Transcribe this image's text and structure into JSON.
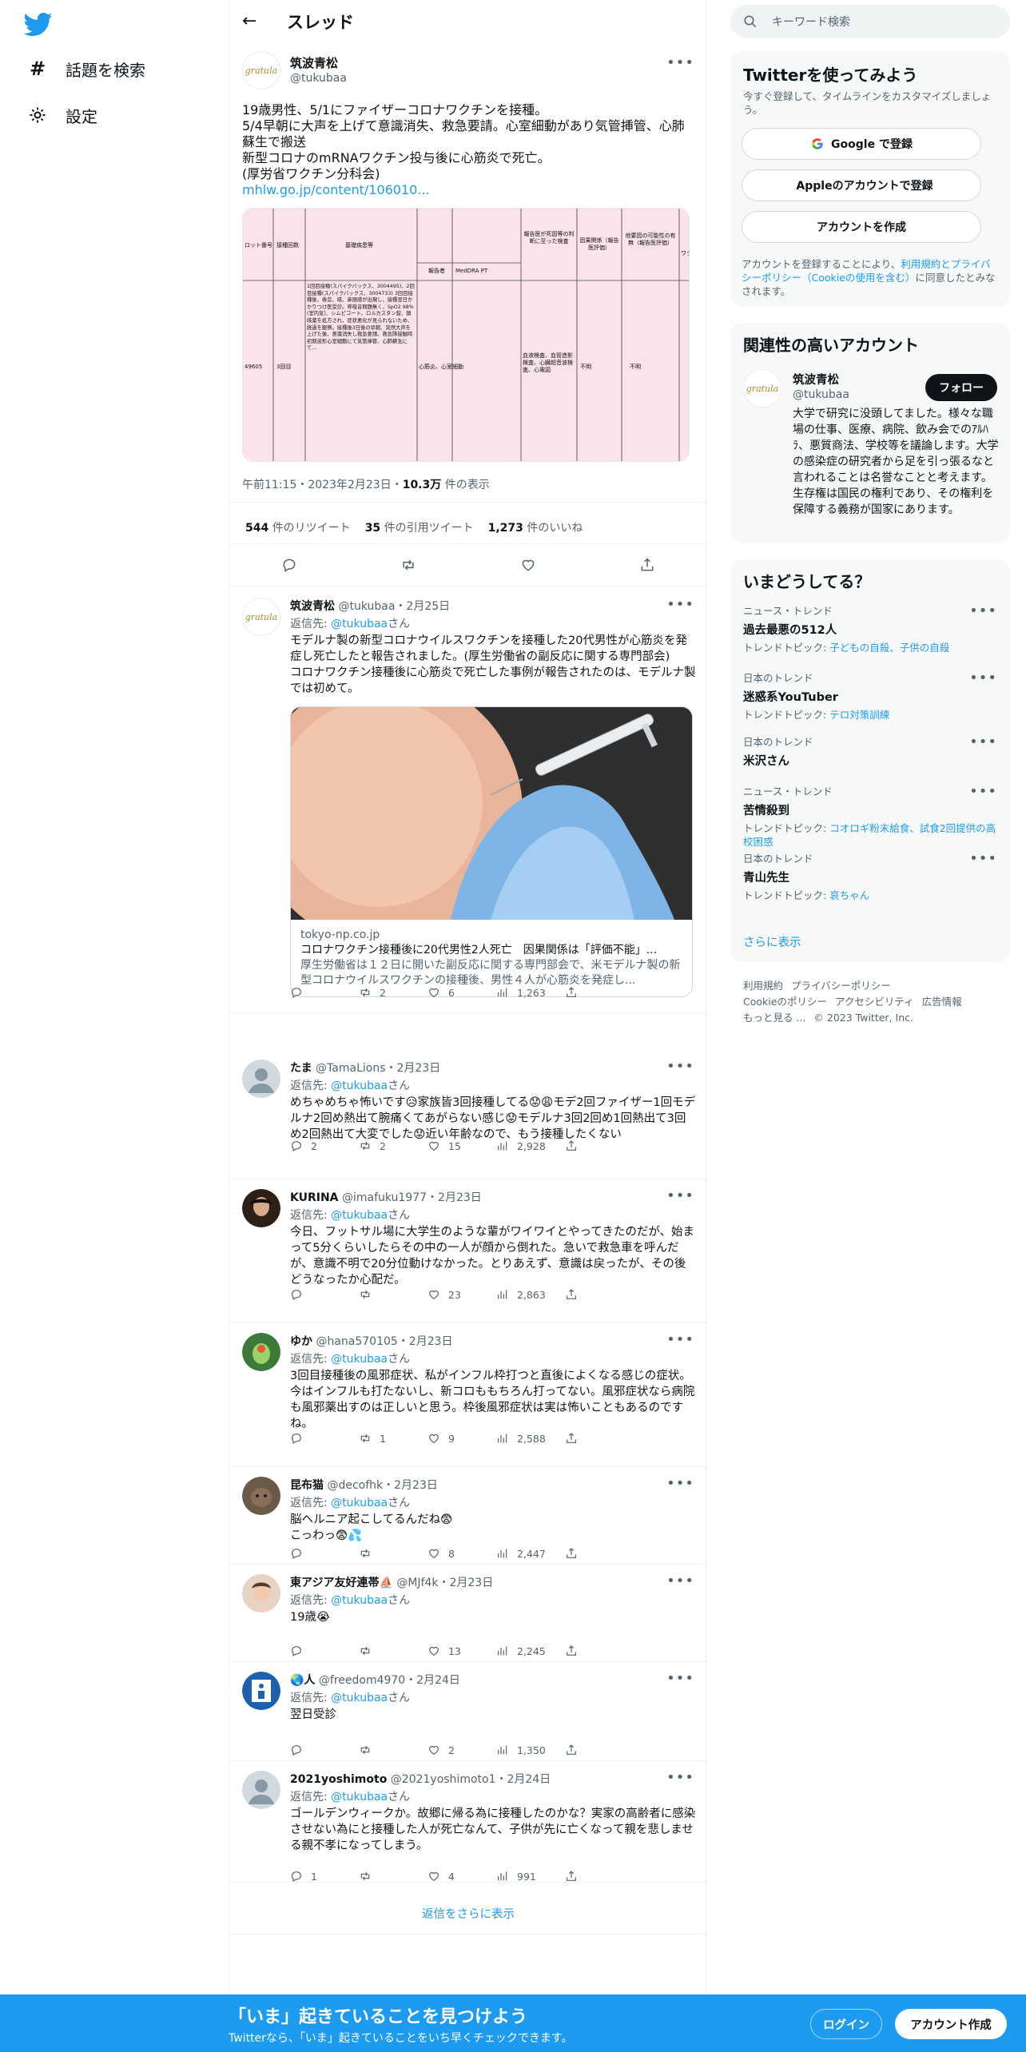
{
  "nav": {
    "explore_label": "話題を検索",
    "settings_label": "設定"
  },
  "header": {
    "title": "スレッド"
  },
  "main_tweet": {
    "name": "筑波青松",
    "handle": "@tukubaa",
    "avatar_text": "gratula",
    "text": "19歳男性、5/1にファイザーコロナワクチンを接種。\n5/4早朝に大声を上げて意識消失、救急要請。心室細動があり気管挿管、心肺蘇生で搬送\n新型コロナのmRNAワクチン投与後に心筋炎で死亡。\n(厚労省ワクチン分科会)",
    "link": "mhlw.go.jp/content/106010...",
    "time": "午前11:15・2023年2月23日・",
    "views": "10.3万",
    "views_label": " 件の表示",
    "retweets": "544",
    "retweets_label": "件のリツイート",
    "quotes": "35",
    "quotes_label": "件の引用ツイート",
    "likes": "1,273",
    "likes_label": "件のいいね",
    "doc": {
      "h1": "ロット番号",
      "h2": "接種回数",
      "h3": "基礎疾患等",
      "h4": "報告者",
      "h5": "MedDRA PT",
      "h6": "報告医が死因等の判断に至った検査",
      "h7": "因果関係（報告医評価）",
      "h8": "他要因の可能性の有無（報告医評価）",
      "h9": "ワク",
      "c1": "49605",
      "c2": "3回目",
      "c3": "1回目接種(スパイクバックス、3004495)、2回目接種(スパイクバックス、3004733) 3回目接種後、倦怠、咳、鼻閉感が出現し、接種翌日かかりつけ医受診。呼吸音問題無く、SpO2 98%(室内気)、シムビコート、ロルカスタン錠、鎮咳薬を処方され、症状悪化が見られないため、経過を観察。接種後3日後の早朝、突然大声を上げた後、意識消失し救急要請。救急隊接触時初期波形心室細動にて気管挿管、心肺蘇生にて...",
      "c4": "心筋炎、心室細動",
      "c5": "血液検査、血管造影検査、心臓超音波検査、心電図",
      "c6": "不明",
      "c7": "不明"
    }
  },
  "card": {
    "domain": "tokyo-np.co.jp",
    "title": "コロナワクチン接種後に20代男性2人死亡　因果関係は「評価不能」...",
    "desc": "厚生労働省は１２日に開いた副反応に関する専門部会で、米モデルナ製の新型コロナウイルスワクチンの接種後、男性４人が心筋炎を発症し..."
  },
  "replies": [
    {
      "name": "筑波青松",
      "meta": "@tukubaa・2月25日",
      "to_label": "返信先: ",
      "to": "@tukubaa",
      "to_suffix": "さん",
      "text": "モデルナ製の新型コロナウイルスワクチンを接種した20代男性が心筋炎を発症し死亡したと報告されました。(厚生労働省の副反応に関する専門部会)\nコロナワクチン接種後に心筋炎で死亡した事例が報告されたのは、モデルナ製では初めて。",
      "replies": "",
      "retweets": "2",
      "likes": "6",
      "views": "1,263"
    },
    {
      "name": "たま",
      "meta": "@TamaLions・2月23日",
      "to_label": "返信先: ",
      "to": "@tukubaa",
      "to_suffix": "さん",
      "text": "めちゃめちゃ怖いです😥家族皆3回接種してる😟😩モデ2回ファイザー1回モデルナ2回め熱出て腕痛くてあがらない感じ😟モデルナ3回2回め1回熱出て3回め2回熱出て大変でした😟近い年齢なので、もう接種したくない",
      "replies": "2",
      "retweets": "2",
      "likes": "15",
      "views": "2,928"
    },
    {
      "name": "KURINA",
      "meta": "@imafuku1977・2月23日",
      "to_label": "返信先: ",
      "to": "@tukubaa",
      "to_suffix": "さん",
      "text": "今日、フットサル場に大学生のような輩がワイワイとやってきたのだが、始まって5分くらいしたらその中の一人が顔から倒れた。急いで救急車を呼んだが、意識不明で20分位動けなかった。とりあえず、意識は戻ったが、その後どうなったか心配だ。",
      "replies": "",
      "retweets": "",
      "likes": "23",
      "views": "2,863"
    },
    {
      "name": "ゆか",
      "meta": "@hana570105・2月23日",
      "to_label": "返信先: ",
      "to": "@tukubaa",
      "to_suffix": "さん",
      "text": "3回目接種後の風邪症状、私がインフル枠打つと直後によくなる感じの症状。今はインフルも打たないし、新コロももちろん打ってない。風邪症状なら病院も風邪薬出すのは正しいと思う。枠後風邪症状は実は怖いこともあるのですね。",
      "replies": "",
      "retweets": "1",
      "likes": "9",
      "views": "2,588"
    },
    {
      "name": "昆布猫",
      "meta": "@decofhk・2月23日",
      "to_label": "返信先: ",
      "to": "@tukubaa",
      "to_suffix": "さん",
      "text": "脳ヘルニア起こしてるんだね😨\nこっわっ😨💦",
      "replies": "",
      "retweets": "",
      "likes": "8",
      "views": "2,447"
    },
    {
      "name": "東アジア友好連帯⛵",
      "meta": "@MJf4k・2月23日",
      "to_label": "返信先: ",
      "to": "@tukubaa",
      "to_suffix": "さん",
      "text": "19歳😭",
      "replies": "",
      "retweets": "",
      "likes": "13",
      "views": "2,245"
    },
    {
      "name": "🌏人",
      "meta": "@freedom4970・2月24日",
      "to_label": "返信先: ",
      "to": "@tukubaa",
      "to_suffix": "さん",
      "text": "翌日受診",
      "replies": "",
      "retweets": "",
      "likes": "2",
      "views": "1,350"
    },
    {
      "name": "2021yoshimoto",
      "meta": "@2021yoshimoto1・2月24日",
      "to_label": "返信先: ",
      "to": "@tukubaa",
      "to_suffix": "さん",
      "text": "ゴールデンウィークか。故郷に帰る為に接種したのかな？実家の高齢者に感染させない為にと接種した人が死亡なんて、子供が先に亡くなって親を悲しませる親不孝になってしまう。",
      "replies": "1",
      "retweets": "",
      "likes": "4",
      "views": "991"
    }
  ],
  "show_more": "返信をさらに表示",
  "sidebar": {
    "search_placeholder": "キーワード検索",
    "signup_title": "Twitterを使ってみよう",
    "signup_sub": "今すぐ登録して、タイムラインをカスタマイズしましょう。",
    "google_btn": "Google で登録",
    "apple_btn": "Appleのアカウントで登録",
    "create_btn": "アカウントを作成",
    "terms_pre": "アカウントを登録することにより、",
    "terms_link": "利用規約とプライバシーポリシー（Cookieの使用を含む）",
    "terms_post": "に同意したとみなされます。",
    "related_title": "関連性の高いアカウント",
    "related_name": "筑波青松",
    "related_handle": "@tukubaa",
    "follow_btn": "フォロー",
    "related_bio": "大学で研究に没頭してました。様々な職場の仕事、医療、病院、飲み会でのｱﾙﾊﾗ、悪質商法、学校等を議論します。大学の感染症の研究者から足を引っ張るなと言われることは名誉なことと考えます。 生存権は国民の権利であり、その権利を保障する義務が国家にあります。",
    "trends_title": "いまどうしてる？",
    "trends": [
      {
        "cat": "ニュース・トレンド",
        "title": "過去最悪の512人",
        "topic_label": "トレンドトピック: ",
        "topic": "子どもの自殺、子供の自殺"
      },
      {
        "cat": "日本のトレンド",
        "title": "迷惑系YouTuber",
        "topic_label": "トレンドトピック: ",
        "topic": "テロ対策訓練"
      },
      {
        "cat": "日本のトレンド",
        "title": "米沢さん",
        "topic_label": "",
        "topic": ""
      },
      {
        "cat": "ニュース・トレンド",
        "title": "苦情殺到",
        "topic_label": "トレンドトピック: ",
        "topic": "コオロギ粉末給食、試食2回提供の高校困惑"
      },
      {
        "cat": "日本のトレンド",
        "title": "青山先生",
        "topic_label": "トレンドトピック: ",
        "topic": "哀ちゃん"
      }
    ],
    "show_more": "さらに表示",
    "footer": [
      "利用規約",
      "プライバシーポリシー",
      "Cookieのポリシー",
      "アクセシビリティ",
      "広告情報",
      "もっと見る ...",
      "© 2023 Twitter, Inc."
    ]
  },
  "banner": {
    "title": "「いま」起きていることを見つけよう",
    "sub": "Twitterなら、「いま」起きていることをいち早くチェックできます。",
    "login": "ログイン",
    "signup": "アカウント作成"
  },
  "colors": {
    "accent": "#1d9bf0",
    "text": "#0f1419",
    "secondary": "#536471",
    "doc_bg": "#fbe4e9"
  }
}
